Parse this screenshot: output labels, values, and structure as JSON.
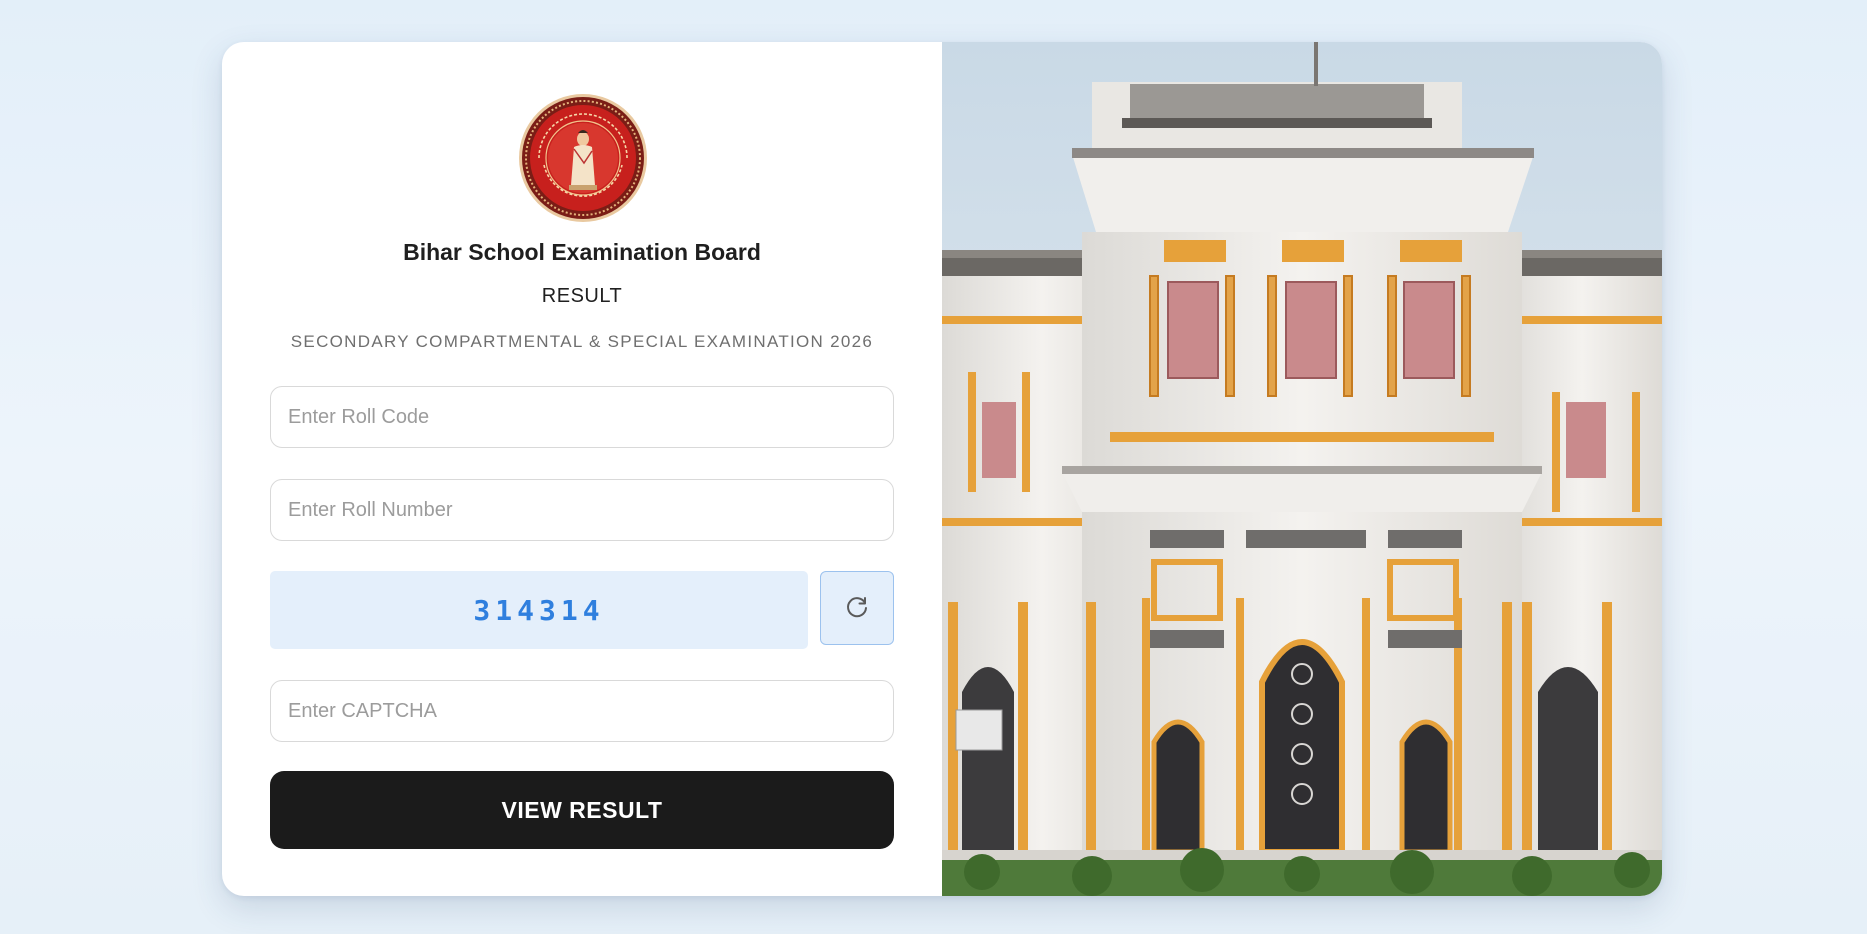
{
  "header": {
    "org_name": "Bihar School Examination Board",
    "subtitle": "RESULT",
    "exam_name": "SECONDARY COMPARTMENTAL & SPECIAL EXAMINATION 2026"
  },
  "form": {
    "roll_code_placeholder": "Enter Roll Code",
    "roll_code_value": "",
    "roll_number_placeholder": "Enter Roll Number",
    "roll_number_value": "",
    "captcha_code": "314314",
    "captcha_placeholder": "Enter CAPTCHA",
    "captcha_value": "",
    "refresh_icon": "refresh-icon",
    "submit_label": "VIEW RESULT"
  },
  "colors": {
    "accent_captcha": "#2f7fde",
    "captcha_bg": "#e4effb",
    "button_bg": "#1b1b1b"
  }
}
